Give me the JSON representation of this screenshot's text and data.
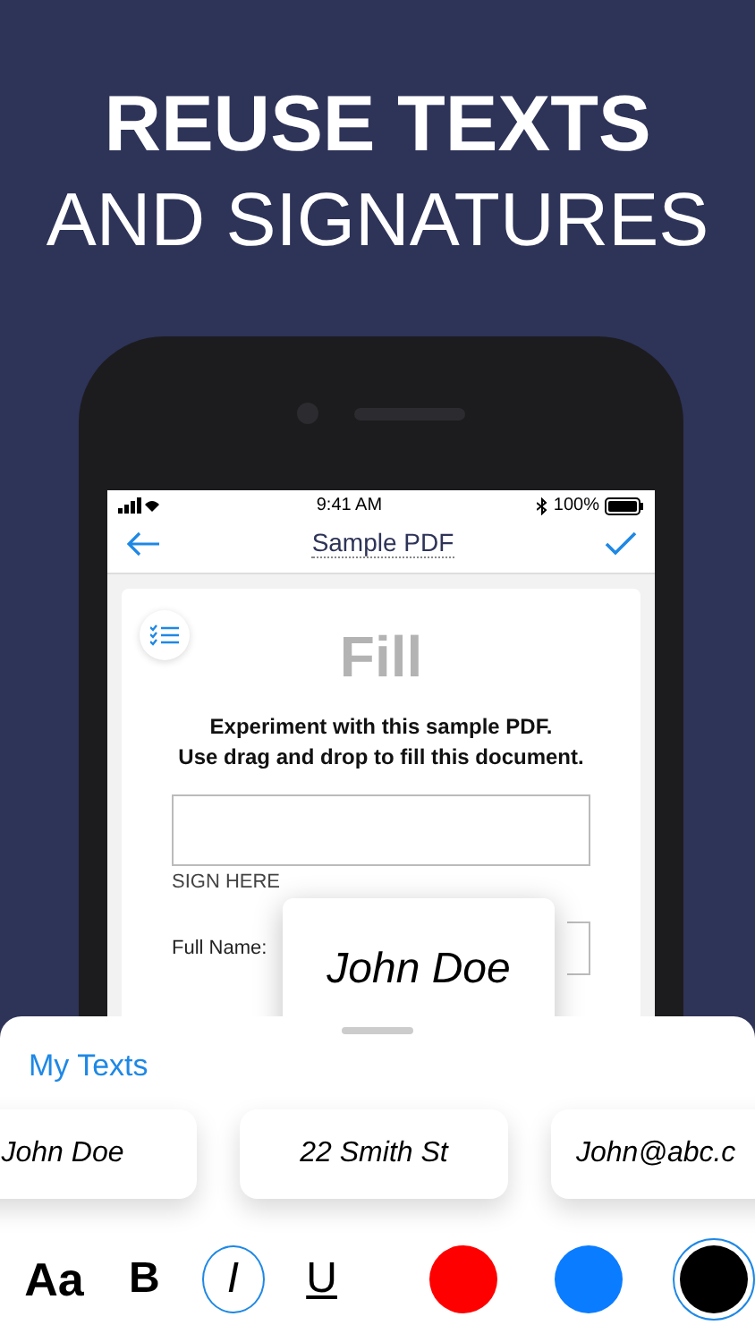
{
  "headline": [
    "REUSE TEXTS",
    "AND SIGNATURES"
  ],
  "status_bar": {
    "time": "9:41 AM",
    "battery": "100%"
  },
  "nav": {
    "title": "Sample PDF"
  },
  "document": {
    "heading": "Fill",
    "instructions": [
      "Experiment with this sample PDF.",
      "Use drag and drop to fill this document."
    ],
    "sign_label": "SIGN HERE",
    "field_label": "Full Name:"
  },
  "popup": {
    "text": "John Doe"
  },
  "sheet": {
    "title": "My Texts",
    "texts": [
      "John Doe",
      "22 Smith St",
      "John@abc.c"
    ],
    "format_buttons": [
      {
        "label": "Aa",
        "kind": "size",
        "selected": false
      },
      {
        "label": "B",
        "kind": "bold",
        "selected": false
      },
      {
        "label": "I",
        "kind": "italic",
        "selected": true
      },
      {
        "label": "U",
        "kind": "underline",
        "selected": false
      }
    ],
    "colors": [
      {
        "color": "#ff0000",
        "selected": false
      },
      {
        "color": "#0a7cff",
        "selected": false
      },
      {
        "color": "#000000",
        "selected": true
      }
    ]
  }
}
